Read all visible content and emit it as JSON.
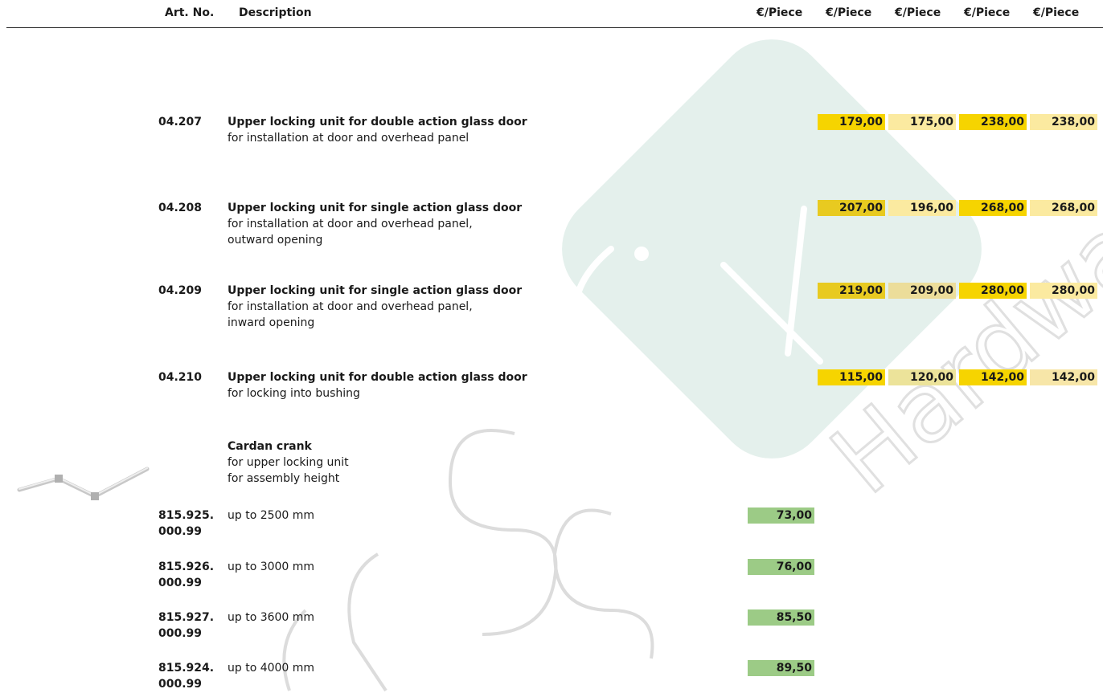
{
  "header": {
    "art_no": "Art. No.",
    "description": "Description",
    "price_cols": [
      "€/Piece",
      "€/Piece",
      "€/Piece",
      "€/Piece",
      "€/Piece"
    ]
  },
  "watermark": {
    "brand": "Hardware"
  },
  "products": [
    {
      "art": "04.207",
      "title": "Upper locking unit for double action glass door",
      "desc": [
        "for installation at door and overhead panel"
      ],
      "prices": [
        "179,00",
        "175,00",
        "238,00",
        "238,00"
      ]
    },
    {
      "art": "04.208",
      "title": "Upper locking unit for single action glass door",
      "desc": [
        "for installation at door and overhead panel,",
        "outward opening"
      ],
      "prices": [
        "207,00",
        "196,00",
        "268,00",
        "268,00"
      ]
    },
    {
      "art": "04.209",
      "title": "Upper locking unit for single action glass door",
      "desc": [
        "for installation at door and overhead panel,",
        "inward opening"
      ],
      "prices": [
        "219,00",
        "209,00",
        "280,00",
        "280,00"
      ]
    },
    {
      "art": "04.210",
      "title": "Upper locking unit for double action glass door",
      "desc": [
        "for locking into bushing"
      ],
      "prices": [
        "115,00",
        "120,00",
        "142,00",
        "142,00"
      ]
    }
  ],
  "cardan": {
    "title": "Cardan crank",
    "desc": [
      "for upper locking unit",
      "for assembly height"
    ],
    "items": [
      {
        "art1": "815.925.",
        "art2": "000.99",
        "desc": "up to 2500 mm",
        "price": "73,00"
      },
      {
        "art1": "815.926.",
        "art2": "000.99",
        "desc": "up to 3000 mm",
        "price": "76,00"
      },
      {
        "art1": "815.927.",
        "art2": "000.99",
        "desc": "up to 3600 mm",
        "price": "85,50"
      },
      {
        "art1": "815.924.",
        "art2": "000.99",
        "desc": "up to 4000 mm",
        "price": "89,50"
      }
    ]
  },
  "colors": {
    "yellow_strong": "#f6d400",
    "yellow_light": "#fbeaa0",
    "green": "#9ccb86",
    "watermark": "#e3efea"
  }
}
